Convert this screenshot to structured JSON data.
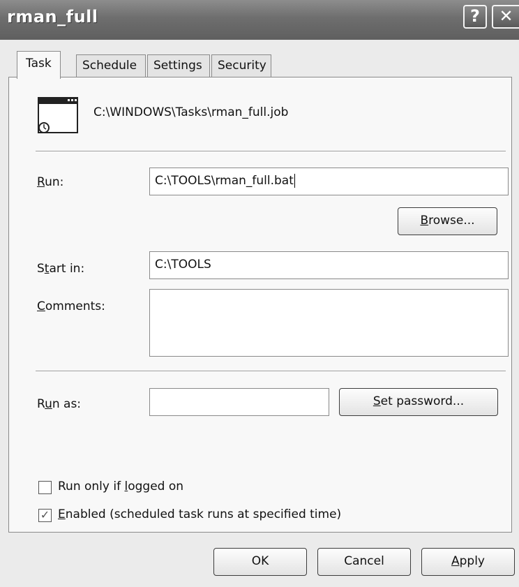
{
  "window": {
    "title": "rman_full",
    "help_glyph": "?",
    "close_glyph": "✕"
  },
  "tabs": [
    {
      "label": "Task",
      "active": true
    },
    {
      "label": "Schedule",
      "active": false
    },
    {
      "label": "Settings",
      "active": false
    },
    {
      "label": "Security",
      "active": false
    }
  ],
  "task": {
    "file_path": "C:\\WINDOWS\\Tasks\\rman_full.job",
    "run": {
      "label": "Run:",
      "value": "C:\\TOOLS\\rman_full.bat"
    },
    "browse_label": "Browse...",
    "start_in": {
      "label": "Start in:",
      "value": "C:\\TOOLS"
    },
    "comments": {
      "label": "Comments:",
      "value": ""
    },
    "run_as": {
      "label": "Run as:",
      "value": ""
    },
    "set_password_label": "Set password...",
    "run_only_logged_on": {
      "label": "Run only if logged on",
      "checked": false
    },
    "enabled": {
      "label": "Enabled (scheduled task runs at specified time)",
      "checked": true
    }
  },
  "footer": {
    "ok_label": "OK",
    "cancel_label": "Cancel",
    "apply_label": "Apply"
  },
  "icons": {
    "task_icon": "scheduled-task-window-icon",
    "help": "question-icon",
    "close": "close-icon"
  }
}
